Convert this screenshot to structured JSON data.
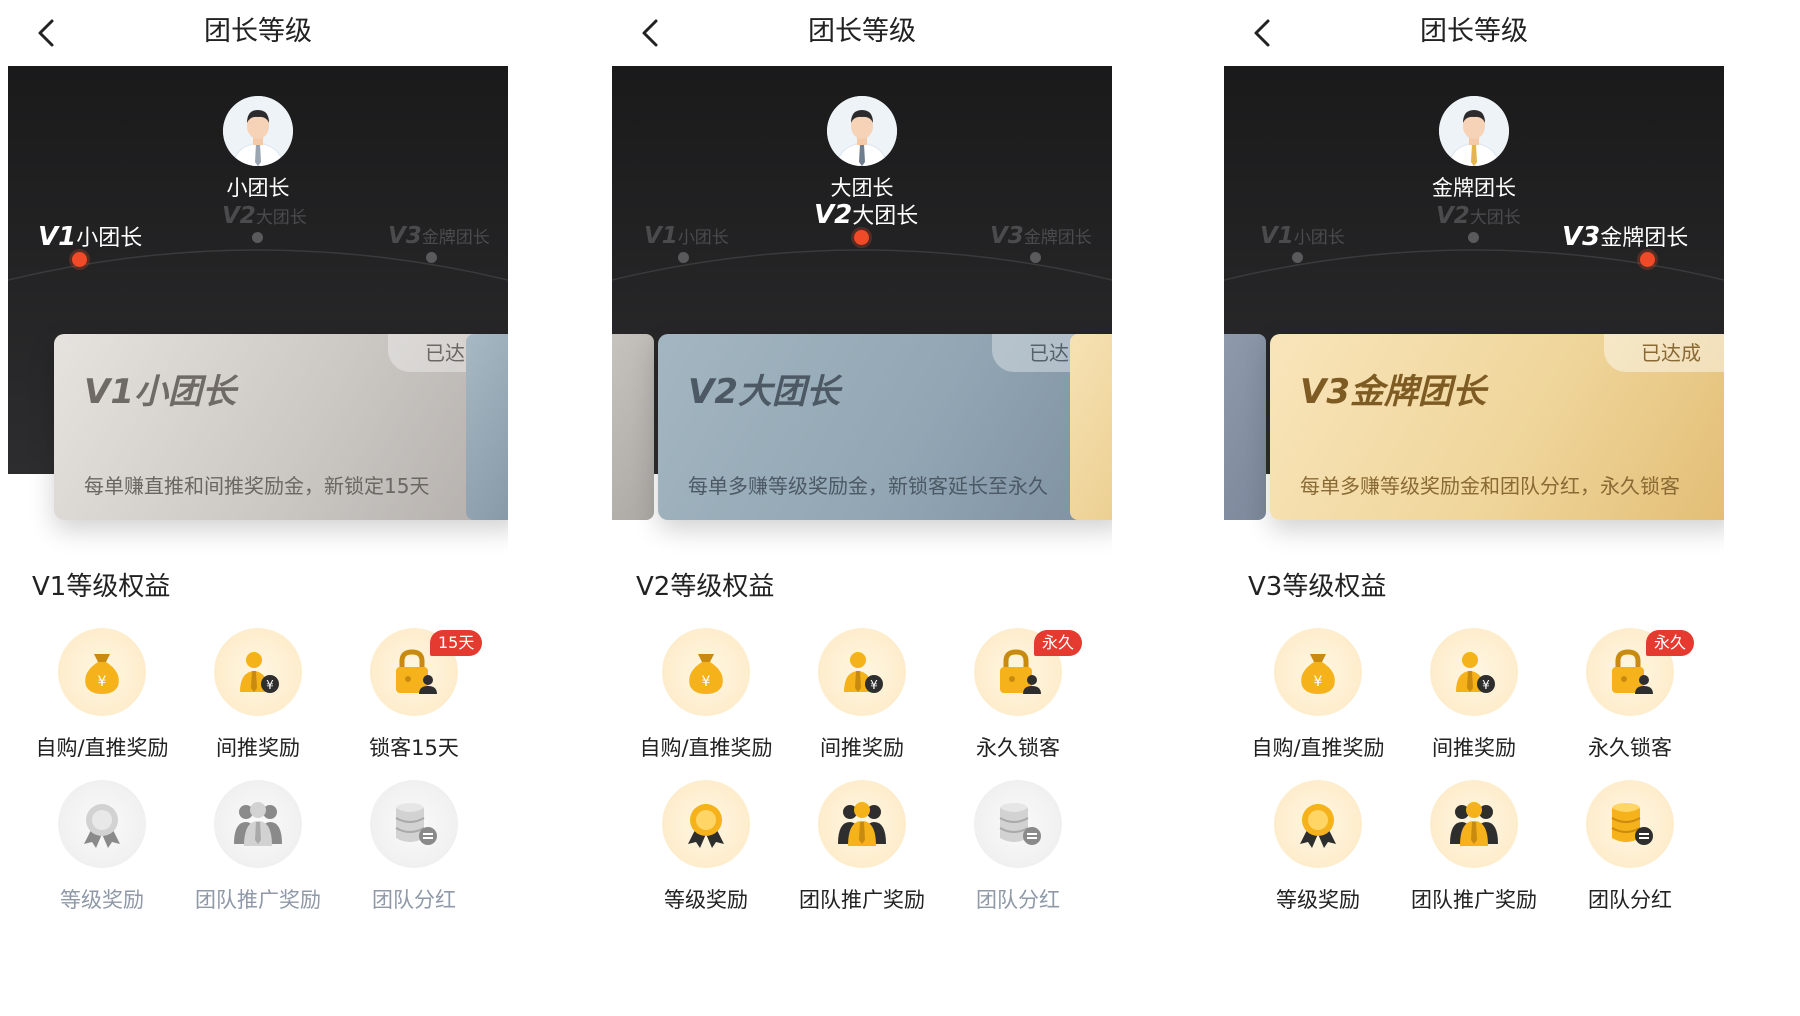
{
  "panels": [
    {
      "header_title": "团长等级",
      "role_name": "小团长",
      "levels": [
        {
          "code": "V1",
          "name": "小团长"
        },
        {
          "code": "V2",
          "name": "大团长"
        },
        {
          "code": "V3",
          "name": "金牌团长"
        }
      ],
      "active_level": 1,
      "card": {
        "title": "V1小团长",
        "status": "已达成",
        "desc": "每单赚直推和间推奖励金，新锁定15天"
      },
      "benefits_title": "V1等级权益",
      "benefits": [
        {
          "label": "自购/直推奖励",
          "icon": "money-bag-icon",
          "enabled": true
        },
        {
          "label": "间推奖励",
          "icon": "person-coin-icon",
          "enabled": true
        },
        {
          "label": "锁客15天",
          "icon": "lock-user-icon",
          "enabled": true,
          "badge": "15天"
        },
        {
          "label": "等级奖励",
          "icon": "medal-icon",
          "enabled": false
        },
        {
          "label": "团队推广奖励",
          "icon": "team-icon",
          "enabled": false
        },
        {
          "label": "团队分红",
          "icon": "coin-stack-icon",
          "enabled": false
        }
      ]
    },
    {
      "header_title": "团长等级",
      "role_name": "大团长",
      "levels": [
        {
          "code": "V1",
          "name": "小团长"
        },
        {
          "code": "V2",
          "name": "大团长"
        },
        {
          "code": "V3",
          "name": "金牌团长"
        }
      ],
      "active_level": 2,
      "card": {
        "title": "V2大团长",
        "status": "已达成",
        "desc": "每单多赚等级奖励金，新锁客延长至永久"
      },
      "benefits_title": "V2等级权益",
      "benefits": [
        {
          "label": "自购/直推奖励",
          "icon": "money-bag-icon",
          "enabled": true
        },
        {
          "label": "间推奖励",
          "icon": "person-coin-icon",
          "enabled": true
        },
        {
          "label": "永久锁客",
          "icon": "lock-user-icon",
          "enabled": true,
          "badge": "永久"
        },
        {
          "label": "等级奖励",
          "icon": "medal-icon",
          "enabled": true
        },
        {
          "label": "团队推广奖励",
          "icon": "team-icon",
          "enabled": true
        },
        {
          "label": "团队分红",
          "icon": "coin-stack-icon",
          "enabled": false
        }
      ]
    },
    {
      "header_title": "团长等级",
      "role_name": "金牌团长",
      "levels": [
        {
          "code": "V1",
          "name": "小团长"
        },
        {
          "code": "V2",
          "name": "大团长"
        },
        {
          "code": "V3",
          "name": "金牌团长"
        }
      ],
      "active_level": 3,
      "card": {
        "title": "V3金牌团长",
        "status": "已达成",
        "desc": "每单多赚等级奖励金和团队分红，永久锁客"
      },
      "benefits_title": "V3等级权益",
      "benefits": [
        {
          "label": "自购/直推奖励",
          "icon": "money-bag-icon",
          "enabled": true
        },
        {
          "label": "间推奖励",
          "icon": "person-coin-icon",
          "enabled": true
        },
        {
          "label": "永久锁客",
          "icon": "lock-user-icon",
          "enabled": true,
          "badge": "永久"
        },
        {
          "label": "等级奖励",
          "icon": "medal-icon",
          "enabled": true
        },
        {
          "label": "团队推广奖励",
          "icon": "team-icon",
          "enabled": true
        },
        {
          "label": "团队分红",
          "icon": "coin-stack-icon",
          "enabled": true
        }
      ]
    }
  ],
  "colors": {
    "accent_dot": "#f04a28",
    "badge_red": "#e53a2f",
    "gold": "#f5b21b",
    "disabled_label": "#8f99a8"
  }
}
